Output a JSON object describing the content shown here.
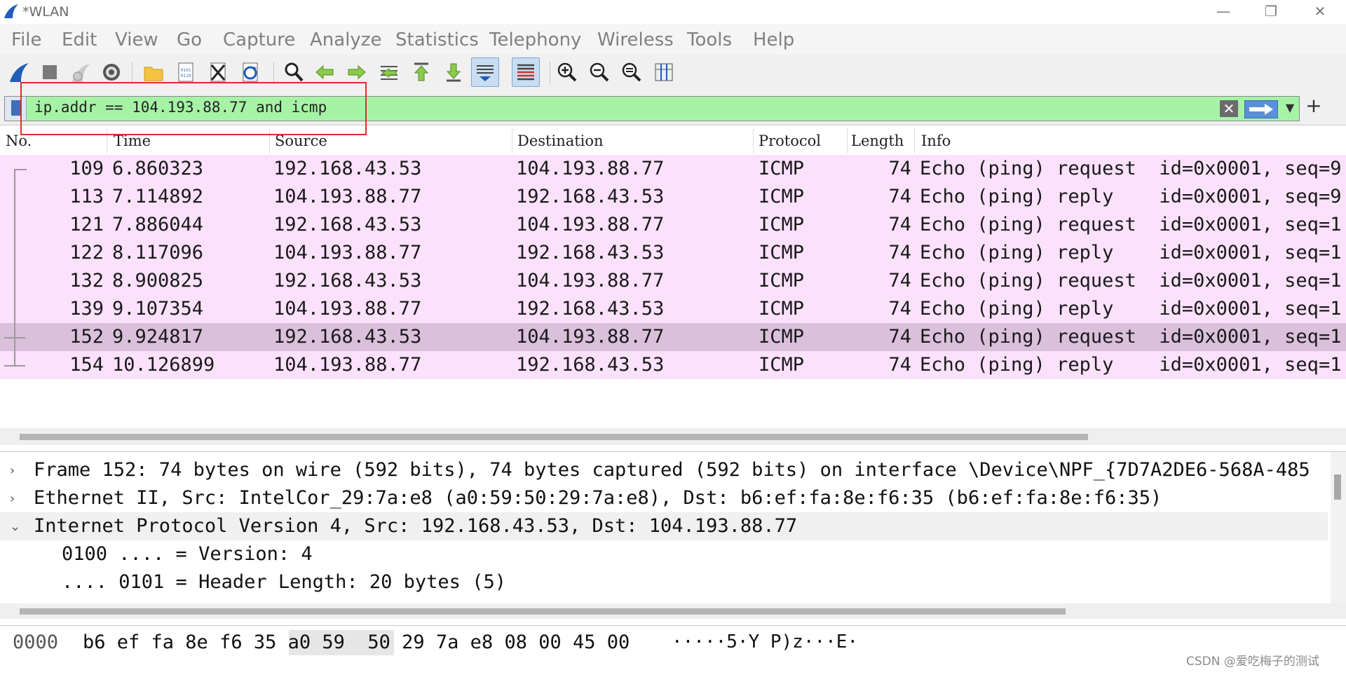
{
  "window": {
    "title": "*WLAN",
    "minimize_glyph": "—",
    "restore_glyph": "❐",
    "close_glyph": "✕"
  },
  "menu": [
    "File",
    "Edit",
    "View",
    "Go",
    "Capture",
    "Analyze",
    "Statistics",
    "Telephony",
    "Wireless",
    "Tools",
    "Help"
  ],
  "toolbar": {
    "icons": [
      "shark-fin-start-icon",
      "stop-icon",
      "restart-fin-icon",
      "capture-options-gear-icon",
      "open-folder-icon",
      "save-file-icon",
      "close-file-icon",
      "reload-icon",
      "find-icon",
      "go-back-icon",
      "go-forward-icon",
      "go-to-packet-icon",
      "first-packet-icon",
      "last-packet-icon",
      "autoscroll-icon",
      "colorize-icon",
      "zoom-in-icon",
      "zoom-out-icon",
      "zoom-normal-icon",
      "resize-columns-icon"
    ]
  },
  "filter": {
    "value": "ip.addr == 104.193.88.77 and icmp",
    "clear_glyph": "✕",
    "dropdown_glyph": "▼",
    "add_glyph": "+",
    "background_color": "#a6f3a6"
  },
  "packet_list": {
    "columns": [
      "No.",
      "Time",
      "Source",
      "Destination",
      "Protocol",
      "Length",
      "Info"
    ],
    "rows": [
      {
        "no": "109",
        "time": "6.860323",
        "source": "192.168.43.53",
        "destination": "104.193.88.77",
        "protocol": "ICMP",
        "length": "74",
        "info": "Echo (ping) request  id=0x0001, seq=9"
      },
      {
        "no": "113",
        "time": "7.114892",
        "source": "104.193.88.77",
        "destination": "192.168.43.53",
        "protocol": "ICMP",
        "length": "74",
        "info": "Echo (ping) reply    id=0x0001, seq=9"
      },
      {
        "no": "121",
        "time": "7.886044",
        "source": "192.168.43.53",
        "destination": "104.193.88.77",
        "protocol": "ICMP",
        "length": "74",
        "info": "Echo (ping) request  id=0x0001, seq=1"
      },
      {
        "no": "122",
        "time": "8.117096",
        "source": "104.193.88.77",
        "destination": "192.168.43.53",
        "protocol": "ICMP",
        "length": "74",
        "info": "Echo (ping) reply    id=0x0001, seq=1"
      },
      {
        "no": "132",
        "time": "8.900825",
        "source": "192.168.43.53",
        "destination": "104.193.88.77",
        "protocol": "ICMP",
        "length": "74",
        "info": "Echo (ping) request  id=0x0001, seq=1"
      },
      {
        "no": "139",
        "time": "9.107354",
        "source": "104.193.88.77",
        "destination": "192.168.43.53",
        "protocol": "ICMP",
        "length": "74",
        "info": "Echo (ping) reply    id=0x0001, seq=1"
      },
      {
        "no": "152",
        "time": "9.924817",
        "source": "192.168.43.53",
        "destination": "104.193.88.77",
        "protocol": "ICMP",
        "length": "74",
        "info": "Echo (ping) request  id=0x0001, seq=1"
      },
      {
        "no": "154",
        "time": "10.126899",
        "source": "104.193.88.77",
        "destination": "192.168.43.53",
        "protocol": "ICMP",
        "length": "74",
        "info": "Echo (ping) reply    id=0x0001, seq=1"
      }
    ],
    "selected_index": 6,
    "row_color": "#fbe1fb",
    "selected_color": "#dbc0dc"
  },
  "details": {
    "lines": [
      {
        "chevron": "›",
        "text": "Frame 152: 74 bytes on wire (592 bits), 74 bytes captured (592 bits) on interface \\Device\\NPF_{7D7A2DE6-568A-485"
      },
      {
        "chevron": "›",
        "text": "Ethernet II, Src: IntelCor_29:7a:e8 (a0:59:50:29:7a:e8), Dst: b6:ef:fa:8e:f6:35 (b6:ef:fa:8e:f6:35)"
      },
      {
        "chevron": "⌄",
        "text": "Internet Protocol Version 4, Src: 192.168.43.53, Dst: 104.193.88.77"
      },
      {
        "chevron": "",
        "text": "0100 .... = Version: 4"
      },
      {
        "chevron": "",
        "text": ".... 0101 = Header Length: 20 bytes (5)"
      }
    ]
  },
  "bytes": {
    "offset": "0000",
    "hex": "b6 ef fa 8e f6 35 a0 59  50 29 7a e8 08 00 45 00",
    "ascii": "·····5·Y P)z···E·"
  },
  "watermark": "CSDN @爱吃梅子的测试"
}
